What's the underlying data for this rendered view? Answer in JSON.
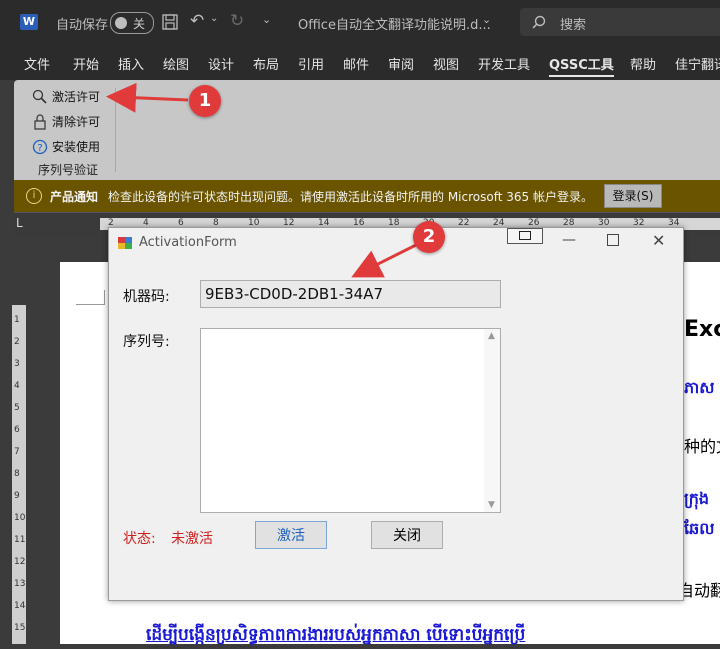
{
  "titlebar": {
    "word_icon": "W",
    "autosave_label": "自动保存",
    "autosave_toggle": "关",
    "save_icon": "save-icon",
    "undo_icon": "undo-icon",
    "redo_icon": "redo-icon",
    "doc_title": "Office自动全文翻译功能说明.d...",
    "search_placeholder": "搜索"
  },
  "menu": {
    "items": [
      "文件",
      "开始",
      "插入",
      "绘图",
      "设计",
      "布局",
      "引用",
      "邮件",
      "审阅",
      "视图",
      "开发工具",
      "QSSC工具",
      "帮助",
      "佳宁翻译"
    ],
    "active": "QSSC工具"
  },
  "ribbon": {
    "buttons": [
      {
        "icon": "magnifier-key-icon",
        "label": "激活许可"
      },
      {
        "icon": "lock-icon",
        "label": "清除许可"
      },
      {
        "icon": "help-circle-icon",
        "label": "安装使用"
      }
    ],
    "group_label": "序列号验证"
  },
  "notification": {
    "title": "产品通知",
    "message": "检查此设备的许可状态时出现问题。请使用激活此设备时所用的 Microsoft 365 帐户登录。",
    "login_button": "登录(S)"
  },
  "ruler": {
    "ticks": [
      "2",
      "4",
      "6",
      "8",
      "10",
      "12",
      "14",
      "16",
      "18",
      "20",
      "22",
      "24",
      "26",
      "28",
      "30",
      "32",
      "34"
    ],
    "vticks": [
      "1",
      "2",
      "3",
      "4",
      "5",
      "6",
      "7",
      "8",
      "9",
      "10",
      "11",
      "12",
      "13",
      "14",
      "15"
    ]
  },
  "document": {
    "fragments": [
      "Exc",
      "ភាស",
      "种的文",
      "ក្រុង",
      "ឆែល",
      "自动翻",
      "ដើម្បីបង្កើនប្រសិទ្ធភាពការងាររបស់អ្នកភាសា បើទោះបីអ្នកប្រើ"
    ]
  },
  "dialog": {
    "title": "ActivationForm",
    "machine_code_label": "机器码:",
    "machine_code_value": "9EB3-CD0D-2DB1-34A7",
    "serial_label": "序列号:",
    "serial_value": "",
    "status_label": "状态:",
    "status_value": "未激活",
    "activate_button": "激活",
    "close_button": "关闭"
  },
  "callouts": [
    "1",
    "2"
  ],
  "colors": {
    "status_red": "#d41f1f",
    "callout_red": "#e03a3a",
    "notify_bg": "#6a5400",
    "ribbon_bg": "#c7c7c7",
    "khmer_blue": "#1a1ad6"
  }
}
